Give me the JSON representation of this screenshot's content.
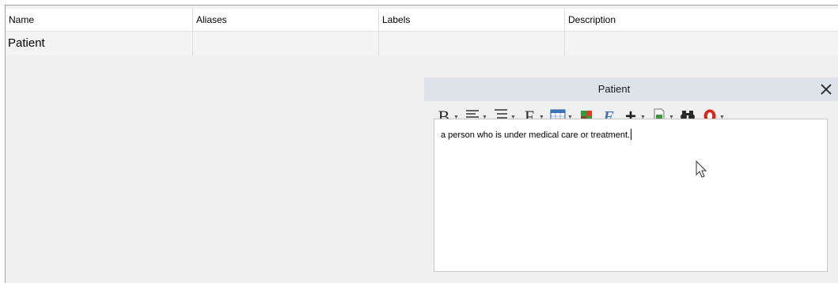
{
  "table": {
    "columns": [
      "Name",
      "Aliases",
      "Labels",
      "Description"
    ],
    "rows": [
      {
        "name": "Patient",
        "aliases": "",
        "labels": "",
        "description": ""
      }
    ]
  },
  "editor": {
    "title": "Patient",
    "close_label": "✕",
    "description_text": "a person who is under medical care or treatment.",
    "toolbar": [
      {
        "id": "bold",
        "icon": "bold-icon",
        "label": "B",
        "dropdown": true
      },
      {
        "id": "align",
        "icon": "align-icon",
        "dropdown": true
      },
      {
        "id": "list",
        "icon": "list-icon",
        "dropdown": true
      },
      {
        "id": "font",
        "icon": "font-icon",
        "label": "F",
        "dropdown": true
      },
      {
        "id": "table",
        "icon": "table-icon",
        "dropdown": true
      },
      {
        "id": "color",
        "icon": "color-icon",
        "dropdown": false
      },
      {
        "id": "formula",
        "icon": "formula-icon",
        "label": "F",
        "dropdown": false
      },
      {
        "id": "insert",
        "icon": "plus-icon",
        "label": "+",
        "dropdown": true
      },
      {
        "id": "document",
        "icon": "document-icon",
        "dropdown": true
      },
      {
        "id": "find",
        "icon": "binoculars-icon",
        "dropdown": false
      },
      {
        "id": "spellcheck",
        "icon": "spellcheck-icon",
        "dropdown": true
      }
    ]
  },
  "colors": {
    "title_bar": "#dde3e9",
    "spell_red": "#d9261c",
    "table_icon_blue": "#3d73b6"
  }
}
